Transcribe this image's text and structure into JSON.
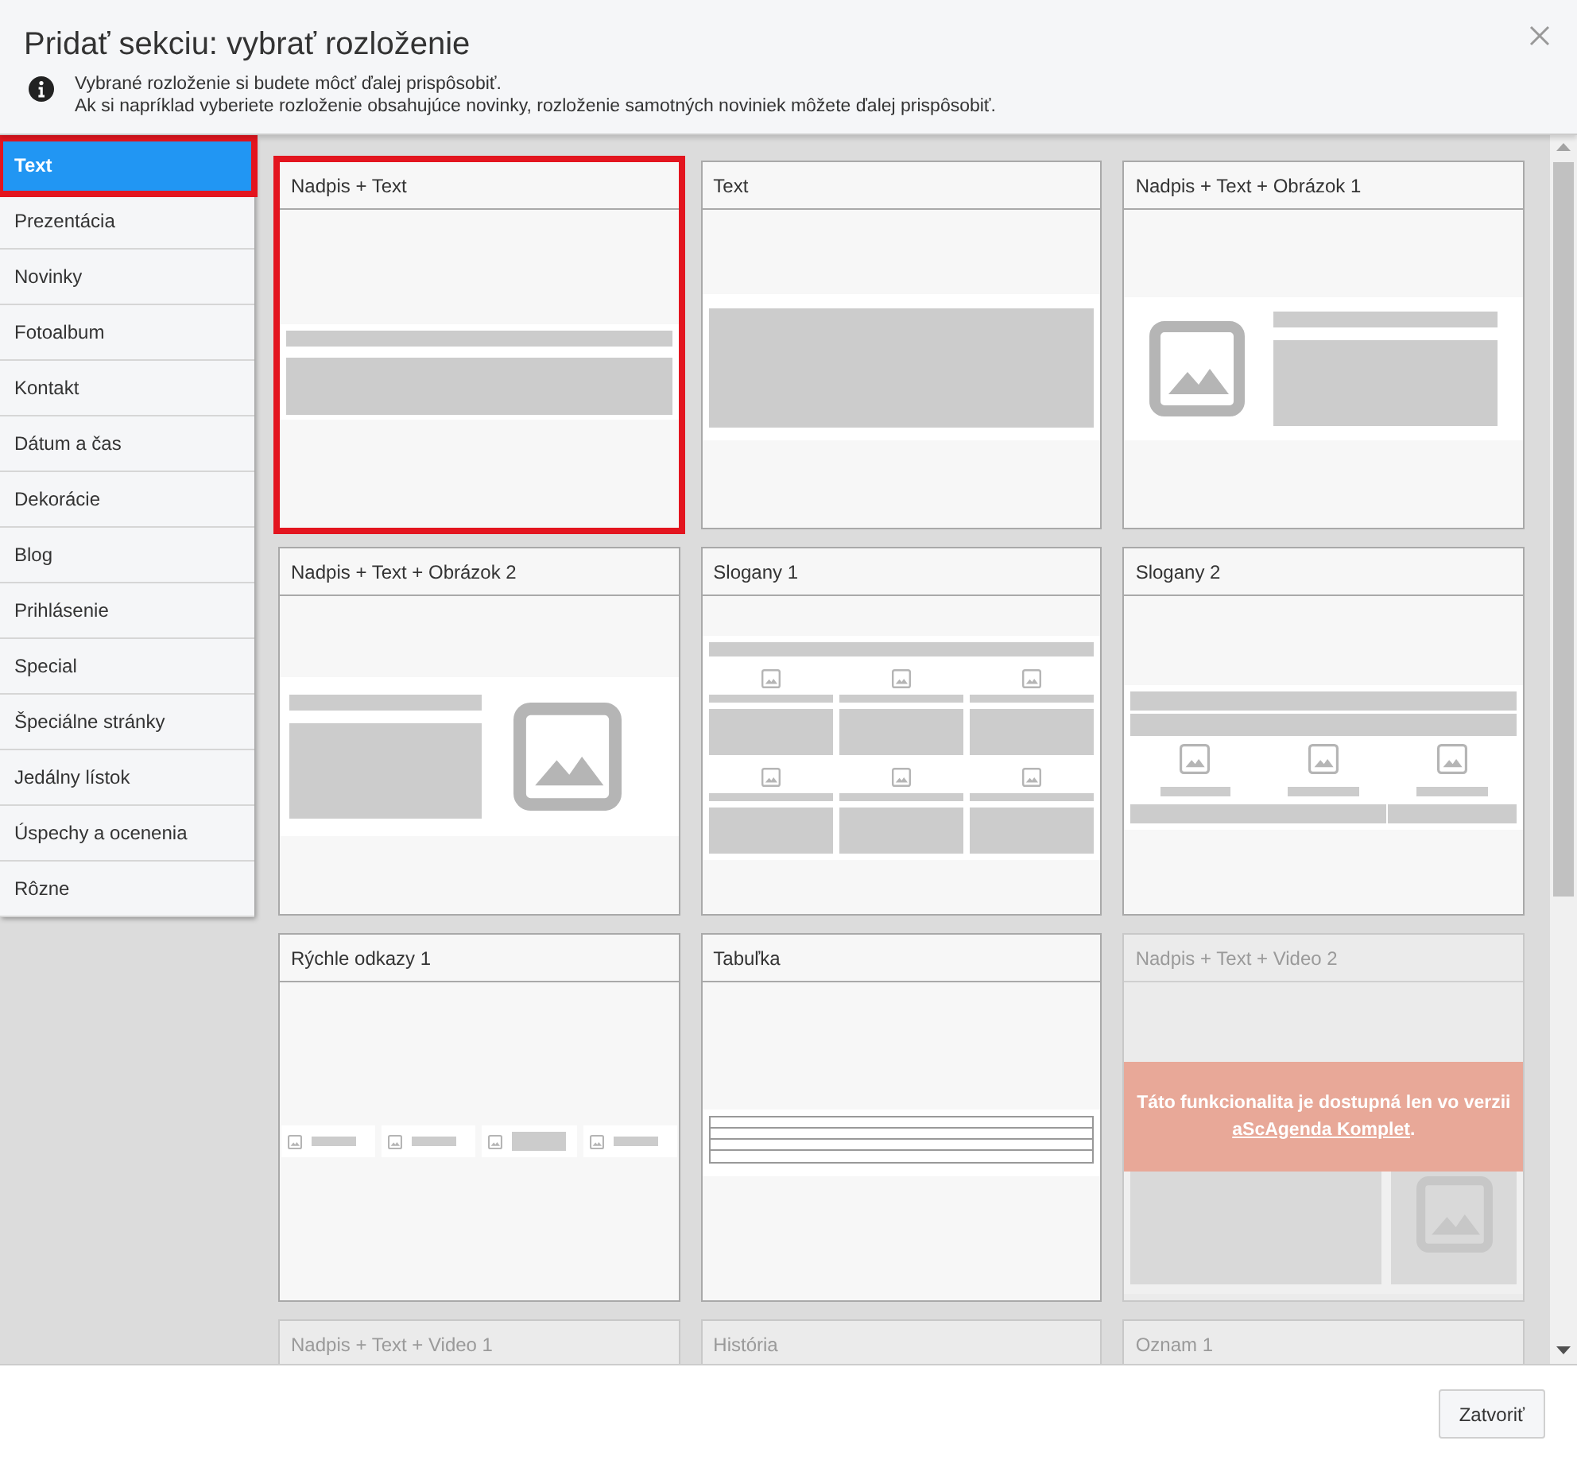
{
  "dialog": {
    "title": "Pridať sekciu: vybrať rozloženie",
    "info_lines": [
      "Vybrané rozloženie si budete môcť ďalej prispôsobiť.",
      "Ak si napríklad vyberiete rozloženie obsahujúce novinky, rozloženie samotných noviniek môžete ďalej prispôsobiť."
    ]
  },
  "sidebar": {
    "items": [
      {
        "label": "Text",
        "selected": true,
        "highlighted": true
      },
      {
        "label": "Prezentácia",
        "selected": false,
        "highlighted": false
      },
      {
        "label": "Novinky",
        "selected": false,
        "highlighted": false
      },
      {
        "label": "Fotoalbum",
        "selected": false,
        "highlighted": false
      },
      {
        "label": "Kontakt",
        "selected": false,
        "highlighted": false
      },
      {
        "label": "Dátum a čas",
        "selected": false,
        "highlighted": false
      },
      {
        "label": "Dekorácie",
        "selected": false,
        "highlighted": false
      },
      {
        "label": "Blog",
        "selected": false,
        "highlighted": false
      },
      {
        "label": "Prihlásenie",
        "selected": false,
        "highlighted": false
      },
      {
        "label": "Special",
        "selected": false,
        "highlighted": false
      },
      {
        "label": "Špeciálne stránky",
        "selected": false,
        "highlighted": false
      },
      {
        "label": "Jedálny lístok",
        "selected": false,
        "highlighted": false
      },
      {
        "label": "Úspechy a ocenenia",
        "selected": false,
        "highlighted": false
      },
      {
        "label": "Rôzne",
        "selected": false,
        "highlighted": false
      }
    ]
  },
  "layouts": [
    {
      "title": "Nadpis + Text",
      "kind": "heading-text",
      "locked": false,
      "highlighted": true
    },
    {
      "title": "Text",
      "kind": "text",
      "locked": false,
      "highlighted": false
    },
    {
      "title": "Nadpis + Text + Obrázok 1",
      "kind": "image-left",
      "locked": false,
      "highlighted": false
    },
    {
      "title": "Nadpis + Text + Obrázok 2",
      "kind": "image-right",
      "locked": false,
      "highlighted": false
    },
    {
      "title": "Slogany 1",
      "kind": "slogans-grid",
      "locked": false,
      "highlighted": false
    },
    {
      "title": "Slogany 2",
      "kind": "slogans-row",
      "locked": false,
      "highlighted": false
    },
    {
      "title": "Rýchle odkazy 1",
      "kind": "quick-links",
      "locked": false,
      "highlighted": false
    },
    {
      "title": "Tabuľka",
      "kind": "table",
      "locked": false,
      "highlighted": false
    },
    {
      "title": "Nadpis + Text + Video 2",
      "kind": "video",
      "locked": true,
      "highlighted": false,
      "lock_message": {
        "text": "Táto funkcionalita je dostupná len vo verzii",
        "link": "aScAgenda Komplet",
        "suffix": "."
      }
    },
    {
      "title": "Nadpis + Text + Video 1",
      "locked": true,
      "highlighted": false
    },
    {
      "title": "História",
      "locked": true,
      "highlighted": false
    },
    {
      "title": "Oznam 1",
      "locked": true,
      "highlighted": false
    }
  ],
  "footer": {
    "close_button": "Zatvoriť"
  }
}
